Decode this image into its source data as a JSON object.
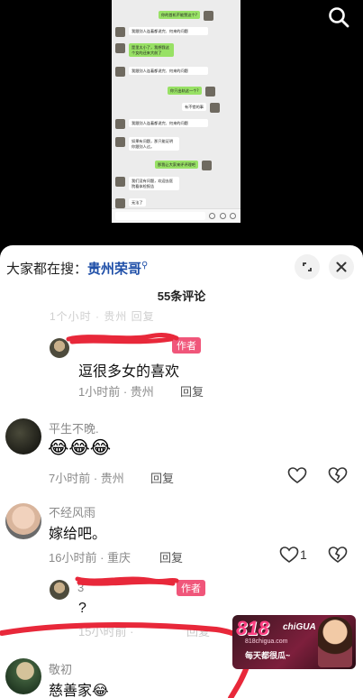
{
  "video": {
    "search_icon": "search-icon",
    "chat": [
      {
        "side": "right",
        "text": "你的首机不能赞这个?"
      },
      {
        "side": "left",
        "text": "我跟别人连着都说完、何来的问题"
      },
      {
        "side": "left",
        "text": "是里太小了，我想我这个女的还来大前了"
      },
      {
        "side": "left",
        "text": "我跟别人连着都说完、何来的问题"
      },
      {
        "side": "right",
        "text": "你只出轨这一个?"
      },
      {
        "side": "right",
        "text": "有不错的事"
      },
      {
        "side": "left",
        "text": "我跟别人连着都说完、何来的问题"
      },
      {
        "side": "left",
        "text": "如果有问题，那只能证明你跟别人过。"
      },
      {
        "side": "right",
        "text": "那我让大家来评评理吧"
      },
      {
        "side": "left",
        "text": "我们没有问题，欢迎去医院看体检报告"
      },
      {
        "side": "left",
        "text": "无法了"
      }
    ]
  },
  "sheet": {
    "hot_search_prefix": "大家都在搜：",
    "hot_search_keyword": "贵州荣哥",
    "comment_count": "55条评论",
    "faded_line": "1个小时 ·  贵州  回复",
    "comments": [
      {
        "name": "",
        "tag": "作者",
        "text": "逗很多女的喜欢",
        "time": "1小时前 · 贵州",
        "reply": "回复"
      },
      {
        "name": "平生不晚.",
        "text": "😂😂😂",
        "time": "7小时前 · 贵州",
        "reply": "回复"
      },
      {
        "name": "不经风雨",
        "text": "嫁给吧。",
        "time": "16小时前 · 重庆",
        "reply": "回复",
        "likes": "1"
      },
      {
        "name": "3",
        "tag": "作者",
        "text": "?",
        "time": "15小时前 ·",
        "reply": "回复"
      },
      {
        "name": "敬初",
        "text": "慈善家😂"
      }
    ]
  },
  "ad": {
    "logo": "818",
    "logo_suffix": "chiGUA",
    "domain": "818chigua.com",
    "slogan": "每天都很瓜~"
  },
  "colors": {
    "accent_link": "#1f4fa8",
    "author_tag": "#f0567a",
    "red_scribble": "#e8283a"
  }
}
